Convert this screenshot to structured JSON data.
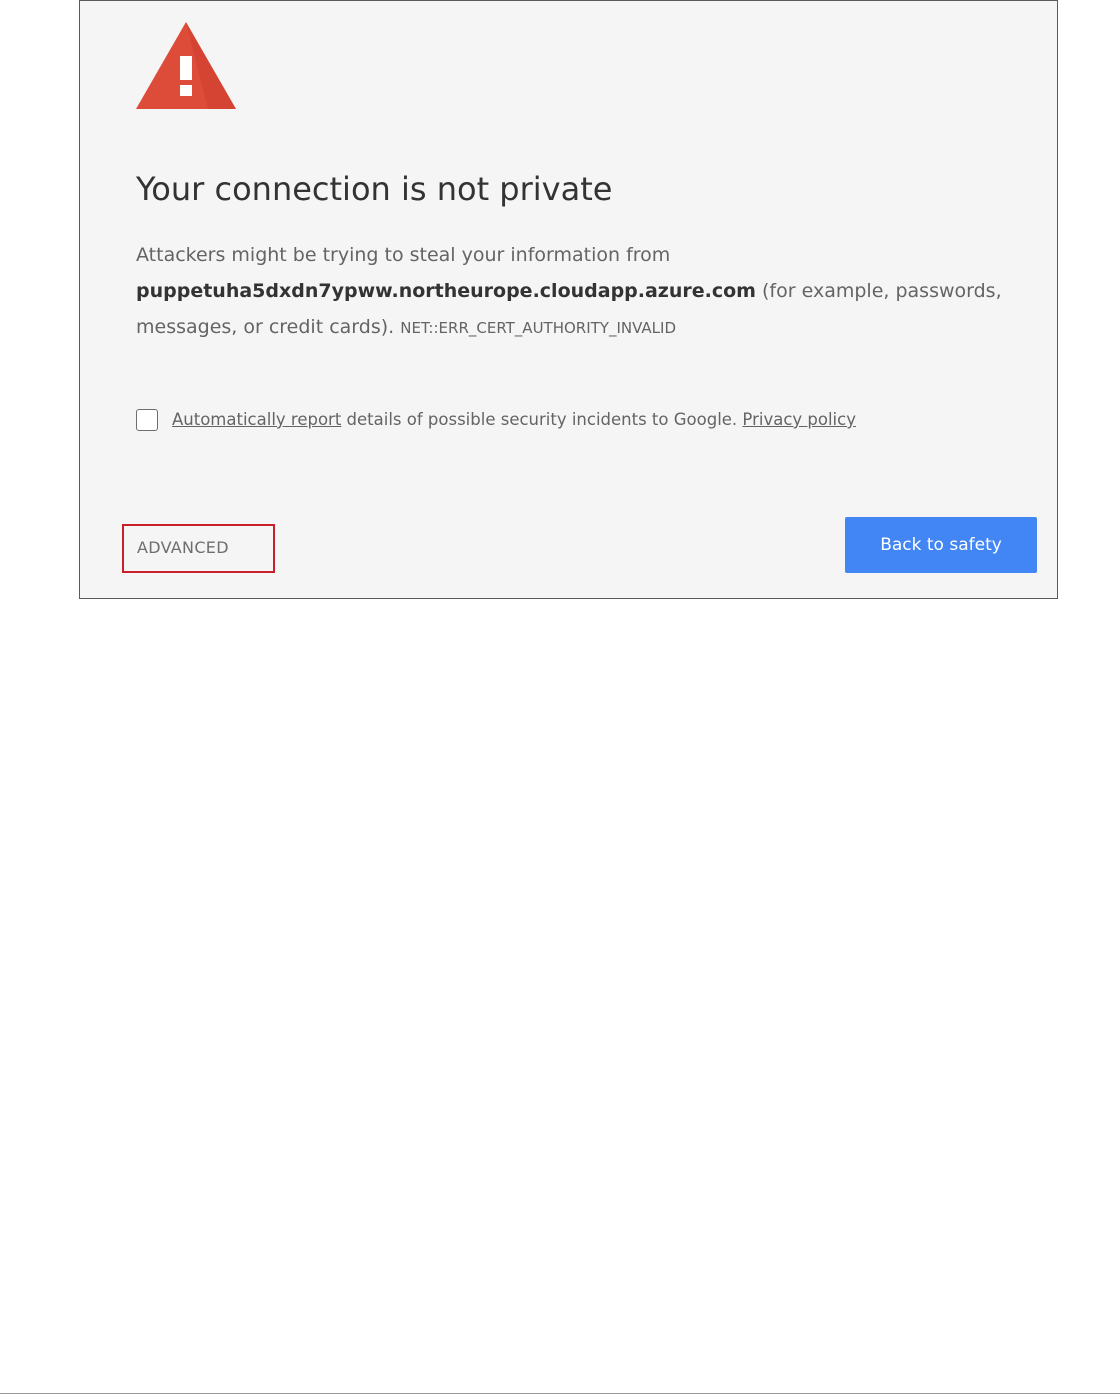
{
  "page": {
    "title": "Your connection is not private",
    "message": {
      "intro": "Attackers might be trying to steal your information from ",
      "host": "puppetuha5dxdn7ypww.northeurope.cloudapp.azure.com",
      "details": " (for example, passwords, messages, or credit cards). ",
      "error_code": "NET::ERR_CERT_AUTHORITY_INVALID"
    },
    "report": {
      "checkbox_checked": false,
      "link_label": "Automatically report",
      "text": " details of possible security incidents to Google. ",
      "privacy_link": "Privacy policy"
    },
    "buttons": {
      "advanced_label": "ADVANCED",
      "back_label": "Back to safety"
    }
  },
  "icons": {
    "warning": "warning-triangle-icon"
  },
  "colors": {
    "warning_red": "#dd4b39",
    "primary_blue": "#4285f4",
    "highlight_box": "#c8202a",
    "panel_background": "#f5f5f5"
  }
}
